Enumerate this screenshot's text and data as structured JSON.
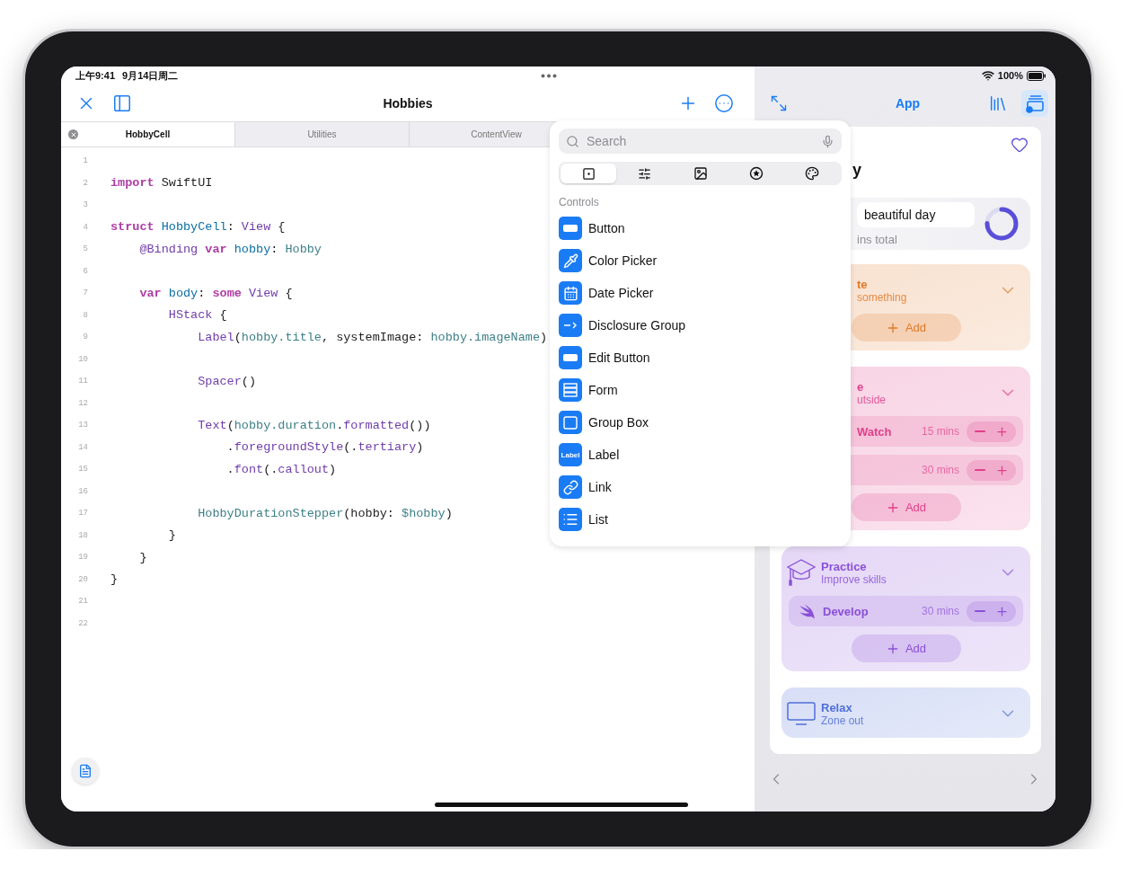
{
  "status_bar": {
    "time": "上午9:41",
    "date": "9月14日周二",
    "battery": "100%"
  },
  "editor": {
    "title": "Hobbies",
    "tabs": [
      {
        "label": "HobbyCell",
        "selected": true
      },
      {
        "label": "Utilities",
        "selected": false
      },
      {
        "label": "ContentView",
        "selected": false
      }
    ],
    "lines": [
      {
        "number": "1"
      },
      {
        "number": "2",
        "tokens": [
          {
            "text": "import",
            "kind": "keyword"
          },
          {
            "text": " SwiftUI",
            "kind": "plain"
          }
        ]
      },
      {
        "number": "3"
      },
      {
        "number": "4",
        "tokens": [
          {
            "text": "struct",
            "kind": "keyword"
          },
          {
            "text": " HobbyCell",
            "kind": "decl"
          },
          {
            "text": ": ",
            "kind": "plain"
          },
          {
            "text": "View",
            "kind": "type"
          },
          {
            "text": " {",
            "kind": "plain"
          }
        ]
      },
      {
        "number": "5",
        "tokens": [
          {
            "text": "    @Binding",
            "kind": "type"
          },
          {
            "text": " var",
            "kind": "keyword"
          },
          {
            "text": " hobby",
            "kind": "decl"
          },
          {
            "text": ": ",
            "kind": "plain"
          },
          {
            "text": "Hobby",
            "kind": "member"
          }
        ]
      },
      {
        "number": "6"
      },
      {
        "number": "7",
        "tokens": [
          {
            "text": "    var",
            "kind": "keyword"
          },
          {
            "text": " body",
            "kind": "decl"
          },
          {
            "text": ": ",
            "kind": "plain"
          },
          {
            "text": "some",
            "kind": "keyword"
          },
          {
            "text": " View",
            "kind": "type"
          },
          {
            "text": " {",
            "kind": "plain"
          }
        ]
      },
      {
        "number": "8",
        "tokens": [
          {
            "text": "        HStack",
            "kind": "type"
          },
          {
            "text": " {",
            "kind": "plain"
          }
        ]
      },
      {
        "number": "9",
        "tokens": [
          {
            "text": "            Label",
            "kind": "type"
          },
          {
            "text": "(",
            "kind": "plain"
          },
          {
            "text": "hobby.title",
            "kind": "member"
          },
          {
            "text": ", systemImage: ",
            "kind": "plain"
          },
          {
            "text": "hobby.imageName",
            "kind": "member"
          },
          {
            "text": ")",
            "kind": "plain"
          }
        ]
      },
      {
        "number": "10"
      },
      {
        "number": "11",
        "tokens": [
          {
            "text": "            Spacer",
            "kind": "type"
          },
          {
            "text": "()",
            "kind": "plain"
          }
        ]
      },
      {
        "number": "12"
      },
      {
        "number": "13",
        "tokens": [
          {
            "text": "            Text",
            "kind": "type"
          },
          {
            "text": "(",
            "kind": "plain"
          },
          {
            "text": "hobby.duration",
            "kind": "member"
          },
          {
            "text": ".",
            "kind": "plain"
          },
          {
            "text": "formatted",
            "kind": "type"
          },
          {
            "text": "())",
            "kind": "plain"
          }
        ]
      },
      {
        "number": "14",
        "tokens": [
          {
            "text": "                .",
            "kind": "plain"
          },
          {
            "text": "foregroundStyle",
            "kind": "type"
          },
          {
            "text": "(.",
            "kind": "plain"
          },
          {
            "text": "tertiary",
            "kind": "type"
          },
          {
            "text": ")",
            "kind": "plain"
          }
        ]
      },
      {
        "number": "15",
        "tokens": [
          {
            "text": "                .",
            "kind": "plain"
          },
          {
            "text": "font",
            "kind": "type"
          },
          {
            "text": "(.",
            "kind": "plain"
          },
          {
            "text": "callout",
            "kind": "type"
          },
          {
            "text": ")",
            "kind": "plain"
          }
        ]
      },
      {
        "number": "16"
      },
      {
        "number": "17",
        "tokens": [
          {
            "text": "            HobbyDurationStepper",
            "kind": "member"
          },
          {
            "text": "(hobby: ",
            "kind": "plain"
          },
          {
            "text": "$hobby",
            "kind": "member"
          },
          {
            "text": ")",
            "kind": "plain"
          }
        ]
      },
      {
        "number": "18",
        "tokens": [
          {
            "text": "        }",
            "kind": "plain"
          }
        ]
      },
      {
        "number": "19",
        "tokens": [
          {
            "text": "    }",
            "kind": "plain"
          }
        ]
      },
      {
        "number": "20",
        "tokens": [
          {
            "text": "}",
            "kind": "plain"
          }
        ]
      },
      {
        "number": "21"
      },
      {
        "number": "22"
      }
    ]
  },
  "library": {
    "search": {
      "placeholder": "Search"
    },
    "segments": [
      {
        "kind": "controls",
        "selected": true
      },
      {
        "kind": "modifiers",
        "selected": false
      },
      {
        "kind": "media",
        "selected": false
      },
      {
        "kind": "symbols",
        "selected": false
      },
      {
        "kind": "colors",
        "selected": false
      }
    ],
    "section": "Controls",
    "items": [
      {
        "label": "Button",
        "kind": "button"
      },
      {
        "label": "Color Picker",
        "kind": "color_picker"
      },
      {
        "label": "Date Picker",
        "kind": "date_picker"
      },
      {
        "label": "Disclosure Group",
        "kind": "disclosure"
      },
      {
        "label": "Edit Button",
        "kind": "edit_button"
      },
      {
        "label": "Form",
        "kind": "form"
      },
      {
        "label": "Group Box",
        "kind": "group_box"
      },
      {
        "label": "Label",
        "kind": "label",
        "icon_text": "Label"
      },
      {
        "label": "Link",
        "kind": "link"
      },
      {
        "label": "List",
        "kind": "list"
      }
    ]
  },
  "preview": {
    "title": "App",
    "live_preview": true,
    "heading": "y",
    "summary": {
      "value": "beautiful day",
      "caption": "ins total",
      "level": 0.75
    },
    "categories": [
      {
        "kind": "covered",
        "color": "#e07a2a",
        "title": "te",
        "subtitle": "something",
        "add": "Add"
      },
      {
        "kind": "covered",
        "color": "#e0408a",
        "title": "e",
        "subtitle": "utside",
        "items": [
          {
            "name": "Watch",
            "duration": "15 mins"
          },
          {
            "duration": "30 mins"
          }
        ],
        "add": "Add"
      },
      {
        "kind": "cap",
        "color": "#8a50d8",
        "title": "Practice",
        "subtitle": "Improve skills",
        "items": [
          {
            "name": "Develop",
            "duration": "30 mins"
          }
        ],
        "add": "Add"
      },
      {
        "kind": "screen",
        "color": "#4f6fd8",
        "title": "Relax",
        "subtitle": "Zone out"
      }
    ]
  }
}
